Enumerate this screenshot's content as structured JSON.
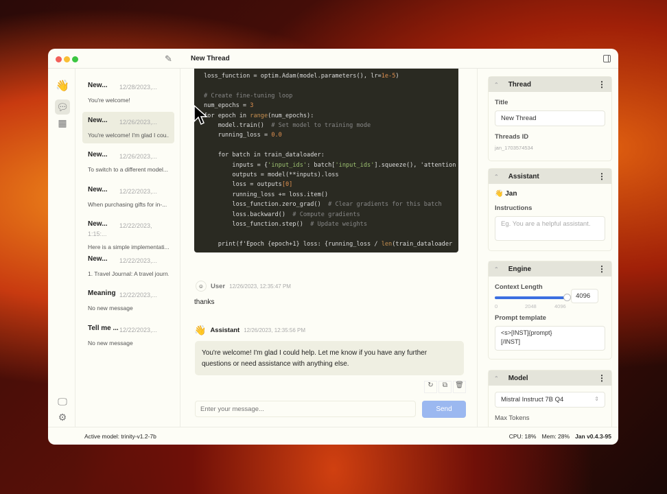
{
  "window": {
    "title": "New Thread"
  },
  "threads": [
    {
      "title": "New...",
      "date": "12/28/2023,...",
      "preview": "You're welcome!"
    },
    {
      "title": "New...",
      "date": "12/26/2023,...",
      "preview": "You're welcome! I'm glad I cou..."
    },
    {
      "title": "New...",
      "date": "12/26/2023,...",
      "preview": "To switch to a different model..."
    },
    {
      "title": "New...",
      "date": "12/22/2023,...",
      "preview": "When purchasing gifts for in-..."
    },
    {
      "title": "New...",
      "date": "12/22/2023, 1:15:...",
      "preview": "Here is a simple implementati..."
    },
    {
      "title": "New...",
      "date": "12/22/2023,...",
      "preview": "1. Travel Journal: A travel journ..."
    },
    {
      "title": "Meaning ...",
      "date": "12/22/2023,...",
      "preview": "No new message"
    },
    {
      "title": "Tell me ...",
      "date": "12/22/2023,...",
      "preview": "No new message"
    }
  ],
  "code_lines": [
    "loss_function = optim.Adam(model.parameters(), lr=1e-5)",
    "",
    "# Create fine-tuning loop",
    "num_epochs = 3",
    "for epoch in range(num_epochs):",
    "    model.train()  # Set model to training mode",
    "    running_loss = 0.0",
    "",
    "    for batch in train_dataloader:",
    "        inputs = {'input_ids': batch['input_ids'].squeeze(), 'attention",
    "        outputs = model(**inputs).loss",
    "        loss = outputs[0]",
    "        running_loss += loss.item()",
    "        loss_function.zero_grad()  # Clear gradients for this batch",
    "        loss.backward()  # Compute gradients",
    "        loss_function.step()  # Update weights",
    "",
    "    print(f'Epoch {epoch+1} loss: {running_loss / len(train_dataloader"
  ],
  "messages": [
    {
      "author": "User",
      "time": "12/26/2023, 12:35:47 PM",
      "text": "thanks"
    },
    {
      "author": "Assistant",
      "time": "12/26/2023, 12:35:56 PM",
      "text": "You're welcome! I'm glad I could help. Let me know if you have any further questions or need assistance with anything else."
    }
  ],
  "composer": {
    "placeholder": "Enter your message...",
    "send": "Send"
  },
  "panel": {
    "thread": {
      "header": "Thread",
      "title_label": "Title",
      "title_value": "New Thread",
      "id_label": "Threads ID",
      "id_value": "jan_1703574534"
    },
    "assistant": {
      "header": "Assistant",
      "name": "Jan",
      "instructions_label": "Instructions",
      "instructions_placeholder": "Eg. You are a helpful assistant."
    },
    "engine": {
      "header": "Engine",
      "context_label": "Context Length",
      "context_value": "4096",
      "context_fraction": 1.0,
      "ticks": [
        "0",
        "2048",
        "4096"
      ],
      "prompt_label": "Prompt template",
      "prompt_value": "<s>[INST]{prompt}\n[/INST]"
    },
    "model": {
      "header": "Model",
      "selected": "Mistral Instruct 7B Q4",
      "max_tokens_label": "Max Tokens"
    }
  },
  "status": {
    "active_model": "Active model: trinity-v1.2-7b",
    "cpu": "CPU: 18%",
    "mem": "Mem: 28%",
    "version": "Jan v0.4.3-95"
  },
  "colors": {
    "accent": "#3b6fe0",
    "send": "#9bb8f0"
  }
}
